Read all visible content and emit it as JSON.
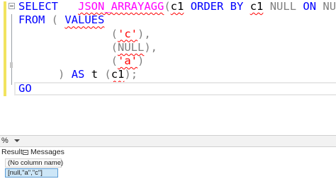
{
  "editor": {
    "lines": [
      {
        "parts": [
          {
            "t": "SELECT",
            "c": "kw"
          },
          {
            "t": "   ",
            "c": ""
          },
          {
            "t": "JSON_ARRAYAGG",
            "c": "fn squig"
          },
          {
            "t": "(",
            "c": "gray"
          },
          {
            "t": "c1",
            "c": "squig"
          },
          {
            "t": " ",
            "c": ""
          },
          {
            "t": "ORDER BY",
            "c": "kw"
          },
          {
            "t": " ",
            "c": ""
          },
          {
            "t": "c1",
            "c": "squig"
          },
          {
            "t": " ",
            "c": ""
          },
          {
            "t": "NULL",
            "c": "gray"
          },
          {
            "t": " ",
            "c": ""
          },
          {
            "t": "ON",
            "c": "kw"
          },
          {
            "t": " ",
            "c": ""
          },
          {
            "t": "NULL",
            "c": "gray"
          },
          {
            "t": " )",
            "c": "gray"
          }
        ]
      },
      {
        "parts": [
          {
            "t": "FROM",
            "c": "kw"
          },
          {
            "t": " ( ",
            "c": "gray"
          },
          {
            "t": "VALUES",
            "c": "kw squig"
          }
        ]
      },
      {
        "parts": [
          {
            "t": "              ",
            "c": ""
          },
          {
            "t": "(",
            "c": "gray"
          },
          {
            "t": "'c'",
            "c": "str squig"
          },
          {
            "t": "),",
            "c": "gray"
          }
        ]
      },
      {
        "parts": [
          {
            "t": "              ",
            "c": ""
          },
          {
            "t": "(",
            "c": "gray"
          },
          {
            "t": "NULL",
            "c": "gray squig"
          },
          {
            "t": "),",
            "c": "gray"
          }
        ]
      },
      {
        "parts": [
          {
            "t": "              ",
            "c": ""
          },
          {
            "t": "(",
            "c": "gray"
          },
          {
            "t": "'a'",
            "c": "str squig"
          },
          {
            "t": ")",
            "c": "gray"
          }
        ]
      },
      {
        "parts": [
          {
            "t": "      ",
            "c": ""
          },
          {
            "t": ")",
            "c": "gray"
          },
          {
            "t": " ",
            "c": ""
          },
          {
            "t": "AS",
            "c": "kw"
          },
          {
            "t": " t ",
            "c": ""
          },
          {
            "t": "(",
            "c": "gray"
          },
          {
            "t": "c1",
            "c": "squig"
          },
          {
            "t": ");",
            "c": "gray"
          }
        ]
      },
      {
        "current": true,
        "parts": [
          {
            "t": "GO",
            "c": "kw"
          }
        ]
      }
    ]
  },
  "zoom": {
    "value": "%"
  },
  "tabs": {
    "results": "Results",
    "messages": "Messages"
  },
  "grid": {
    "column_header": "(No column name)",
    "cell": "[null,\"a\",\"c\"]"
  }
}
